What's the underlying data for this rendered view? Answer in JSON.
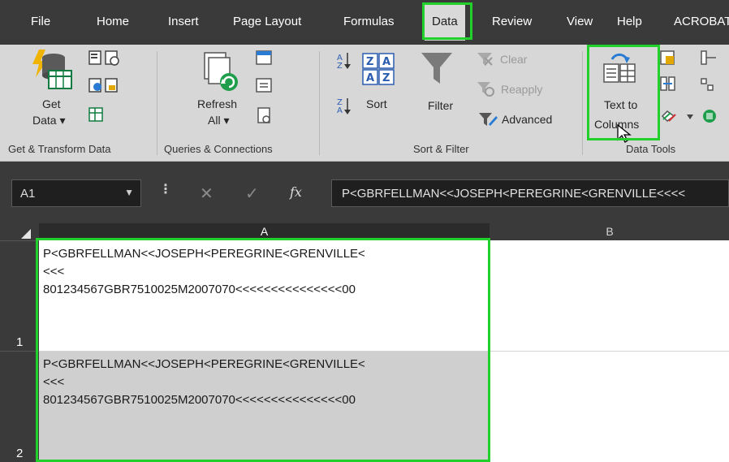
{
  "menu": {
    "tabs": [
      "File",
      "Home",
      "Insert",
      "Page Layout",
      "Formulas",
      "Data",
      "Review",
      "View",
      "Help",
      "ACROBAT"
    ],
    "active_tab": "Data"
  },
  "ribbon": {
    "get_data": {
      "line1": "Get",
      "line2": "Data",
      "arrow": "▾"
    },
    "refresh_all": {
      "line1": "Refresh",
      "line2": "All",
      "arrow": "▾"
    },
    "sort": "Sort",
    "filter": "Filter",
    "clear": "Clear",
    "reapply": "Reapply",
    "advanced": "Advanced",
    "text_to_columns": {
      "line1": "Text to",
      "line2": "Columns"
    },
    "groups": {
      "get_transform": "Get & Transform Data",
      "queries": "Queries & Connections",
      "sort_filter": "Sort & Filter",
      "data_tools": "Data Tools"
    }
  },
  "formula_bar": {
    "name_box": "A1",
    "fx": "fx",
    "cancel": "✕",
    "enter": "✓",
    "content": "P<GBRFELLMAN<<JOSEPH<PEREGRINE<GRENVILLE<<<<"
  },
  "grid": {
    "columns": [
      "A",
      "B"
    ],
    "rows": [
      {
        "header": "1",
        "a": "P<GBRFELLMAN<<JOSEPH<PEREGRINE<GRENVILLE<\n<<<\n801234567GBR7510025M2007070<<<<<<<<<<<<<<<00"
      },
      {
        "header": "2",
        "a": "P<GBRFELLMAN<<JOSEPH<PEREGRINE<GRENVILLE<\n<<<\n801234567GBR7510025M2007070<<<<<<<<<<<<<<<00"
      }
    ]
  },
  "colors": {
    "highlight": "#22d02c",
    "ribbon_bg": "#d7d7d7",
    "dark_chrome": "#3a3a3a",
    "excel_green": "#107c41"
  }
}
